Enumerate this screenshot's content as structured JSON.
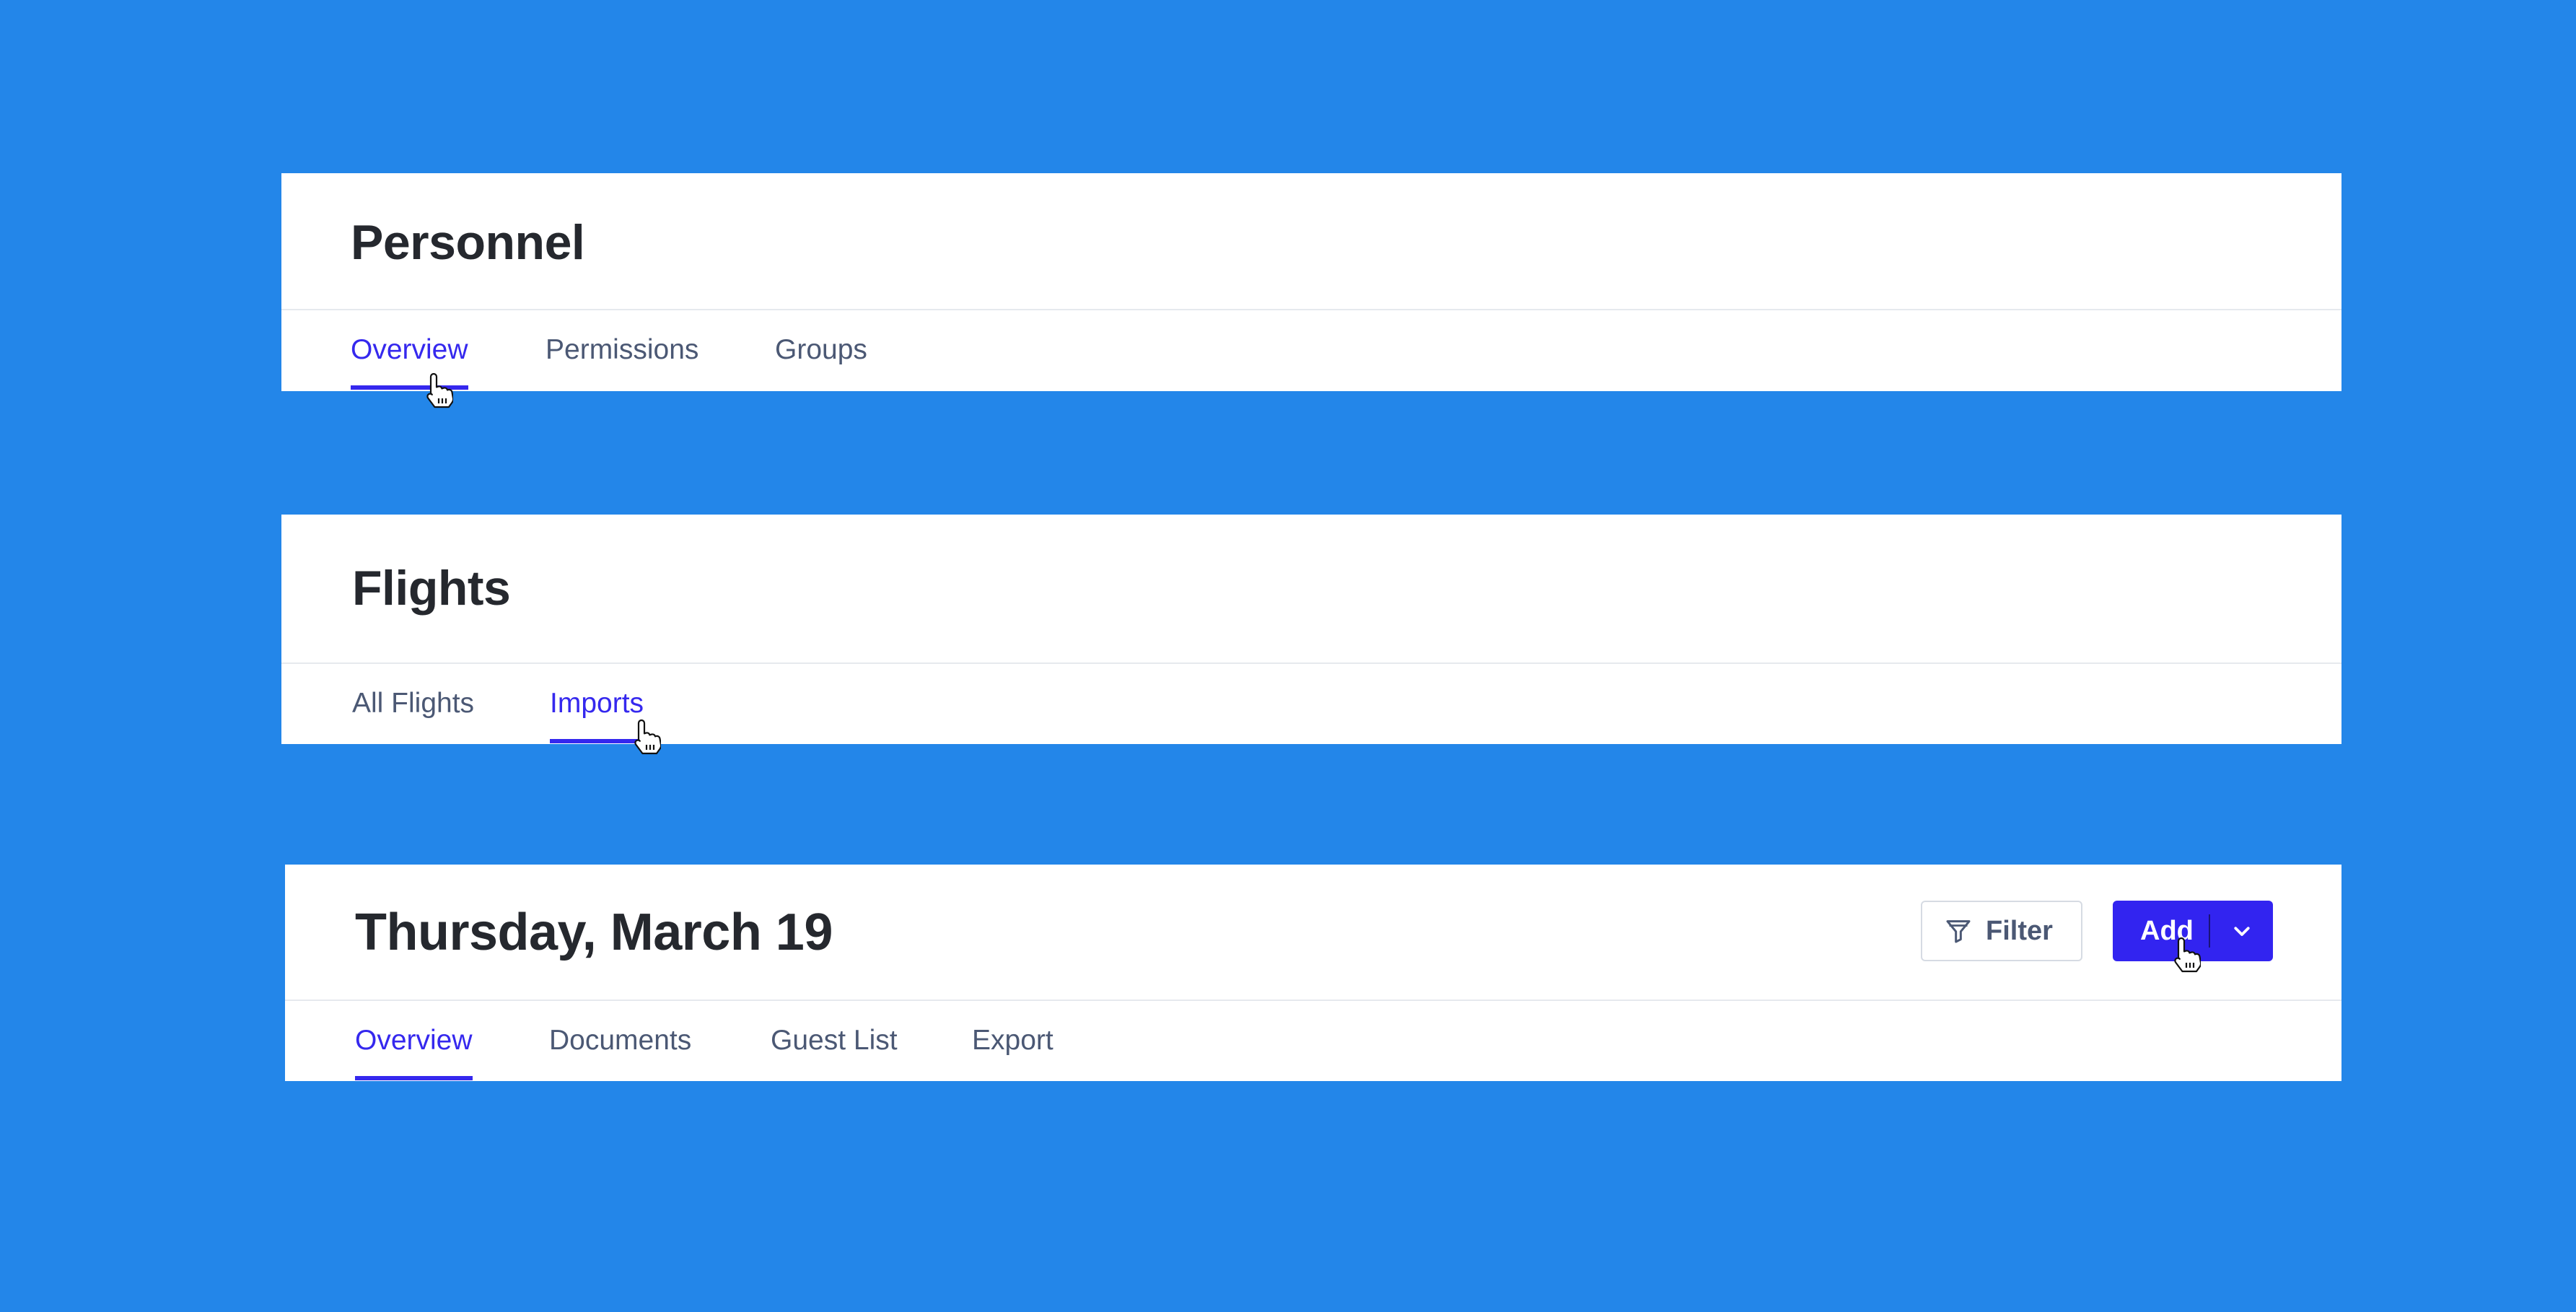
{
  "panels": [
    {
      "title": "Personnel",
      "tabs": [
        {
          "label": "Overview",
          "active": true
        },
        {
          "label": "Permissions",
          "active": false
        },
        {
          "label": "Groups",
          "active": false
        }
      ]
    },
    {
      "title": "Flights",
      "tabs": [
        {
          "label": "All Flights",
          "active": false
        },
        {
          "label": "Imports",
          "active": true
        }
      ]
    },
    {
      "title": "Thursday, March 19",
      "actions": {
        "filter_label": "Filter",
        "filter_icon": "funnel-icon",
        "add_label": "Add",
        "add_menu_icon": "chevron-down-icon"
      },
      "tabs": [
        {
          "label": "Overview",
          "active": true
        },
        {
          "label": "Documents",
          "active": false
        },
        {
          "label": "Guest List",
          "active": false
        },
        {
          "label": "Export",
          "active": false
        }
      ]
    }
  ],
  "colors": {
    "background": "#2386E9",
    "panel": "#FFFFFF",
    "title": "#25282E",
    "tab_inactive": "#4B5874",
    "accent": "#3528EE",
    "add_button": "#3224F0"
  }
}
